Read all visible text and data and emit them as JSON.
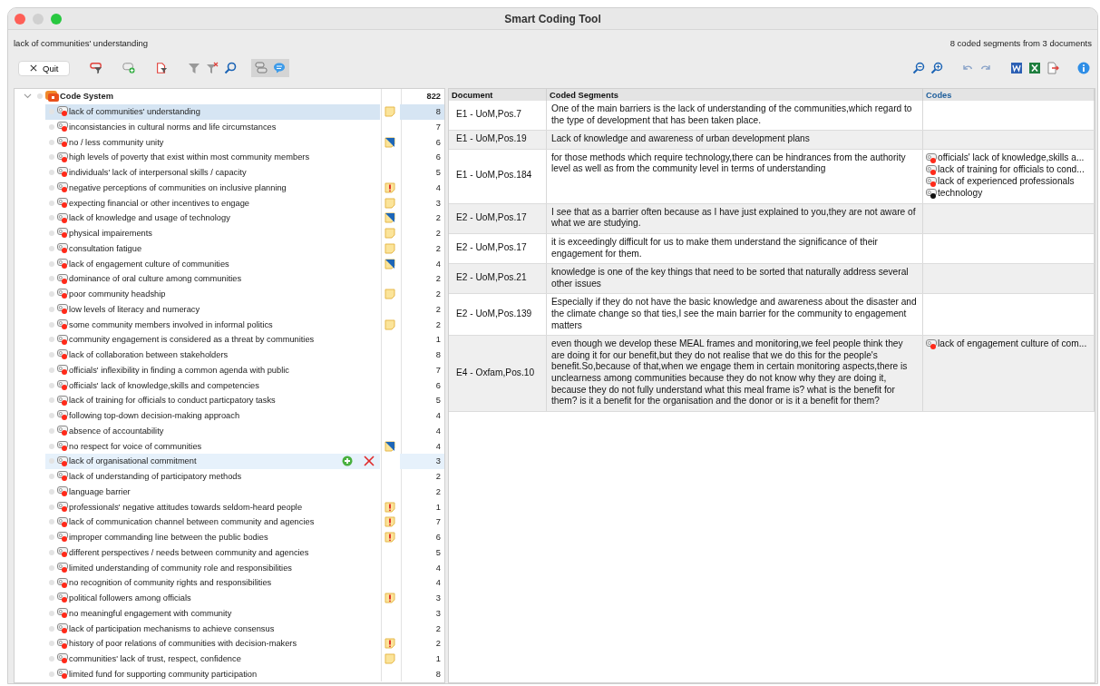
{
  "window": {
    "title": "Smart Coding Tool"
  },
  "info_bar": {
    "selected_code": "lack of communities' understanding",
    "summary": "8 coded segments from 3 documents"
  },
  "toolbar": {
    "quit_button": "Quit"
  },
  "code_system": {
    "label": "Code System",
    "count": "822",
    "expanded": true,
    "children": [
      {
        "label": "lack of communities' understanding",
        "count": "8",
        "memo": {
          "kind": "plain"
        },
        "selected": true,
        "hovered": false
      },
      {
        "label": "inconsistancies in cultural norms and life circumstances",
        "count": "7",
        "selected": false,
        "hovered": false
      },
      {
        "label": "no / less community unity",
        "count": "6",
        "memo": {
          "kind": "link"
        },
        "selected": false,
        "hovered": false
      },
      {
        "label": "high levels of poverty that exist within most community members",
        "count": "6",
        "selected": false,
        "hovered": false
      },
      {
        "label": "individuals' lack of interpersonal skills / capacity",
        "count": "5",
        "selected": false,
        "hovered": false
      },
      {
        "label": "negative perceptions of communities on inclusive planning",
        "count": "4",
        "memo": {
          "kind": "alert"
        },
        "selected": false,
        "hovered": false
      },
      {
        "label": "expecting financial or other incentives to engage",
        "count": "3",
        "memo": {
          "kind": "plain"
        },
        "selected": false,
        "hovered": false
      },
      {
        "label": "lack of knowledge and usage of technology",
        "count": "2",
        "memo": {
          "kind": "link"
        },
        "selected": false,
        "hovered": false
      },
      {
        "label": "physical impairements",
        "count": "2",
        "memo": {
          "kind": "plain"
        },
        "selected": false,
        "hovered": false
      },
      {
        "label": "consultation fatigue",
        "count": "2",
        "memo": {
          "kind": "plain"
        },
        "selected": false,
        "hovered": false
      },
      {
        "label": "lack of engagement culture of communities",
        "count": "4",
        "memo": {
          "kind": "link"
        },
        "selected": false,
        "hovered": false
      },
      {
        "label": "dominance of oral culture among communities",
        "count": "2",
        "selected": false,
        "hovered": false
      },
      {
        "label": "poor community headship",
        "count": "2",
        "memo": {
          "kind": "plain"
        },
        "selected": false,
        "hovered": false
      },
      {
        "label": "low levels of literacy and numeracy",
        "count": "2",
        "selected": false,
        "hovered": false
      },
      {
        "label": "some community members involved in informal politics",
        "count": "2",
        "memo": {
          "kind": "plain"
        },
        "selected": false,
        "hovered": false
      },
      {
        "label": "community engagement is considered as a threat by communities",
        "count": "1",
        "selected": false,
        "hovered": false
      },
      {
        "label": "lack of collaboration between stakeholders",
        "count": "8",
        "selected": false,
        "hovered": false
      },
      {
        "label": "officials' inflexibility in finding a common agenda with public",
        "count": "7",
        "selected": false,
        "hovered": false
      },
      {
        "label": "officials' lack of knowledge,skills and competencies",
        "count": "6",
        "selected": false,
        "hovered": false
      },
      {
        "label": "lack of training for officials to conduct particpatory tasks",
        "count": "5",
        "selected": false,
        "hovered": false
      },
      {
        "label": "following top-down decision-making approach",
        "count": "4",
        "selected": false,
        "hovered": false
      },
      {
        "label": "absence of accountability",
        "count": "4",
        "selected": false,
        "hovered": false
      },
      {
        "label": "no respect for voice of communities",
        "count": "4",
        "memo": {
          "kind": "link"
        },
        "selected": false,
        "hovered": false
      },
      {
        "label": "lack of organisational commitment",
        "count": "3",
        "selected": false,
        "hovered": true
      },
      {
        "label": "lack of understanding of participatory methods",
        "count": "2",
        "selected": false,
        "hovered": false
      },
      {
        "label": "language barrier",
        "count": "2",
        "selected": false,
        "hovered": false
      },
      {
        "label": "professionals' negative attitudes towards seldom-heard people",
        "count": "1",
        "memo": {
          "kind": "alert"
        },
        "selected": false,
        "hovered": false
      },
      {
        "label": "lack of communication channel between community and agencies",
        "count": "7",
        "memo": {
          "kind": "alert"
        },
        "selected": false,
        "hovered": false
      },
      {
        "label": "improper commanding line between the public bodies",
        "count": "6",
        "memo": {
          "kind": "alert"
        },
        "selected": false,
        "hovered": false
      },
      {
        "label": "different perspectives / needs between community and agencies",
        "count": "5",
        "selected": false,
        "hovered": false
      },
      {
        "label": "limited understanding of community role and responsibilities",
        "count": "4",
        "selected": false,
        "hovered": false
      },
      {
        "label": "no recognition of community rights and responsibilities",
        "count": "4",
        "selected": false,
        "hovered": false
      },
      {
        "label": "political followers among officials",
        "count": "3",
        "memo": {
          "kind": "alert"
        },
        "selected": false,
        "hovered": false
      },
      {
        "label": "no meaningful engagement with community",
        "count": "3",
        "selected": false,
        "hovered": false
      },
      {
        "label": "lack of participation mechanisms to achieve consensus",
        "count": "2",
        "selected": false,
        "hovered": false
      },
      {
        "label": "history of poor relations of communities with decision-makers",
        "count": "2",
        "memo": {
          "kind": "alert"
        },
        "selected": false,
        "hovered": false
      },
      {
        "label": "communities' lack of trust, respect, confidence",
        "count": "1",
        "memo": {
          "kind": "plain"
        },
        "selected": false,
        "hovered": false
      },
      {
        "label": "limited fund for supporting community participation",
        "count": "8",
        "selected": false,
        "hovered": false
      }
    ]
  },
  "segments_table": {
    "columns": [
      "Document",
      "Coded Segments",
      "Codes"
    ],
    "rows": [
      {
        "document": "E1 - UoM,Pos.7",
        "segment": "One of the main barriers is the lack of understanding of the communities,which regard to the type of development that has been taken place."
      },
      {
        "document": "E1 - UoM,Pos.19",
        "segment": "Lack of knowledge and awareness of urban development plans"
      },
      {
        "document": "E1 - UoM,Pos.184",
        "segment": "for those methods which require technology,there can be hindrances from the authority level as well as from the community level in terms of understanding",
        "codes": [
          {
            "label": "officials' lack of knowledge,skills a...",
            "color": "#ff2a1a"
          },
          {
            "label": "lack of training for officials to cond...",
            "color": "#ff2a1a"
          },
          {
            "label": "lack of experienced professionals",
            "color": "#ff2a1a"
          },
          {
            "label": "technology",
            "color": "#111111"
          }
        ]
      },
      {
        "document": "E2 - UoM,Pos.17",
        "segment": "I see that as a barrier often because as I have just explained to you,they are not aware of what we are studying."
      },
      {
        "document": "E2 - UoM,Pos.17",
        "segment": "it is exceedingly difficult for us to make them understand the significance of their engagement for them."
      },
      {
        "document": "E2 - UoM,Pos.21",
        "segment": "knowledge is one of the key things that need to be sorted that naturally address several other issues"
      },
      {
        "document": "E2 - UoM,Pos.139",
        "segment": "Especially if they do not have the basic knowledge and awareness about the disaster and the climate change so that ties,I see the main barrier for the community to engagement matters"
      },
      {
        "document": "E4 - Oxfam,Pos.10",
        "segment": "even though we develop these MEAL frames and monitoring,we feel people think they are doing it for our benefit,but they do not realise that we do this for the people's benefit.So,because of that,when we engage them in certain monitoring aspects,there is unclearness among communities because they do not know why they are doing it, because they do not fully understand what this meal frame is? what is the benefit for them? is it a benefit for the organisation and the donor or is it a benefit for them?",
        "codes": [
          {
            "label": "lack of engagement culture of com...",
            "color": "#ff2a1a"
          }
        ]
      }
    ]
  }
}
